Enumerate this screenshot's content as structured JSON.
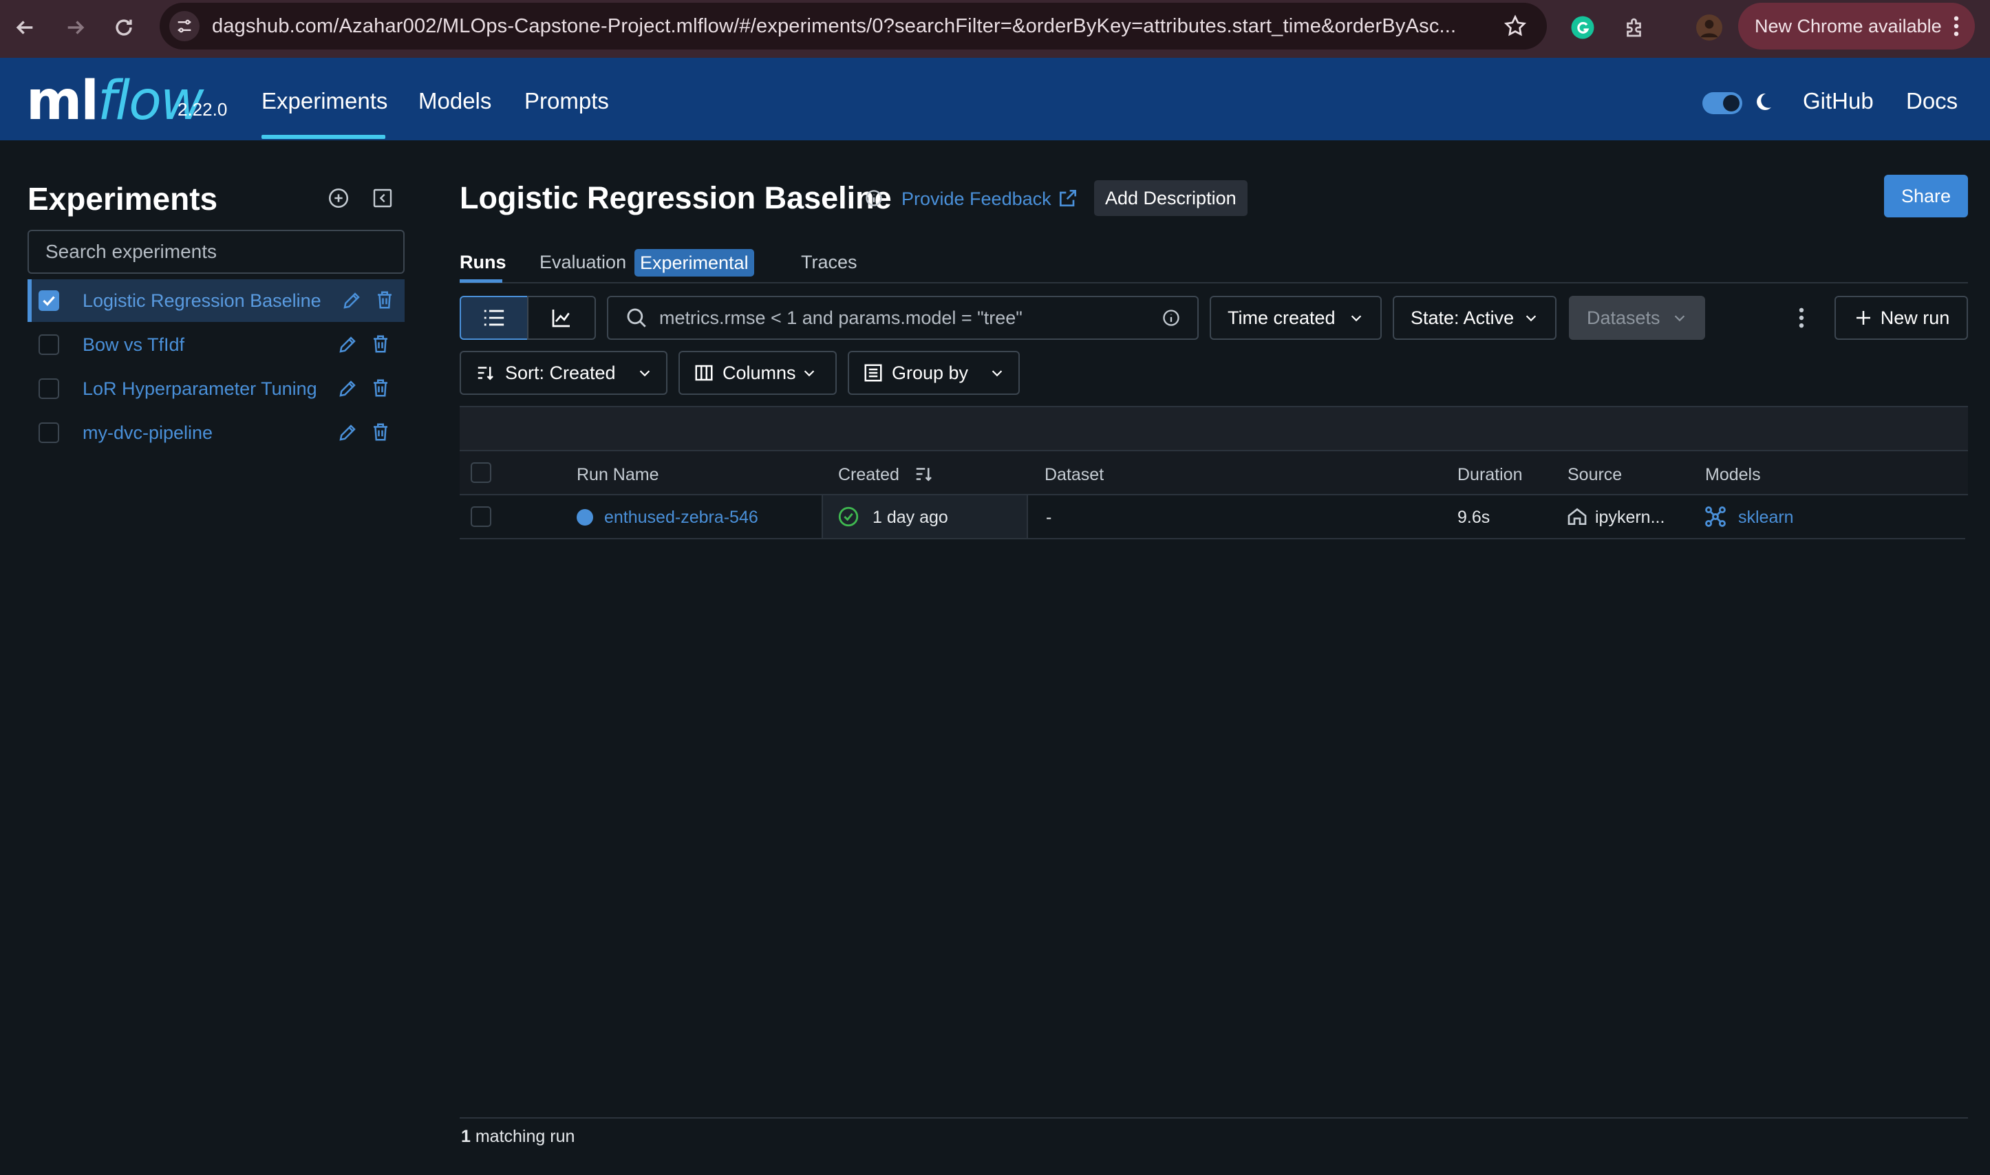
{
  "browser": {
    "url": "dagshub.com/Azahar002/MLOps-Capstone-Project.mlflow/#/experiments/0?searchFilter=&orderByKey=attributes.start_time&orderByAsc...",
    "update_label": "New Chrome available"
  },
  "header": {
    "logo_ml": "ml",
    "logo_flow": "flow",
    "version": "2.22.0",
    "nav": [
      "Experiments",
      "Models",
      "Prompts"
    ],
    "github": "GitHub",
    "docs": "Docs",
    "theme_toggle": "on"
  },
  "sidebar": {
    "title": "Experiments",
    "search_placeholder": "Search experiments",
    "experiments": [
      {
        "name": "Logistic Regression Baseline",
        "selected": true
      },
      {
        "name": "Bow vs TfIdf",
        "selected": false
      },
      {
        "name": "LoR Hyperparameter Tuning",
        "selected": false
      },
      {
        "name": "my-dvc-pipeline",
        "selected": false
      }
    ]
  },
  "main": {
    "title": "Logistic Regression Baseline",
    "feedback_label": "Provide Feedback",
    "add_description_label": "Add Description",
    "share_label": "Share",
    "tabs": {
      "runs": "Runs",
      "evaluation": "Evaluation",
      "evaluation_badge": "Experimental",
      "traces": "Traces"
    },
    "toolbar": {
      "search_placeholder": "metrics.rmse < 1 and params.model = \"tree\"",
      "time_created": "Time created",
      "state": "State: Active",
      "datasets": "Datasets",
      "new_run": "New run",
      "sort": "Sort: Created",
      "columns": "Columns",
      "group_by": "Group by"
    },
    "table": {
      "columns": [
        "Run Name",
        "Created",
        "Dataset",
        "Duration",
        "Source",
        "Models"
      ],
      "rows": [
        {
          "run_name": "enthused-zebra-546",
          "created": "1 day ago",
          "dataset": "-",
          "duration": "9.6s",
          "source": "ipykern...",
          "models": "sklearn"
        }
      ]
    },
    "footer": {
      "count": "1",
      "count_label": " matching run"
    }
  },
  "colors": {
    "accent": "#4a90d9",
    "header_bg": "#0f3c7a",
    "page_bg": "#11171c",
    "success": "#3fb950"
  }
}
